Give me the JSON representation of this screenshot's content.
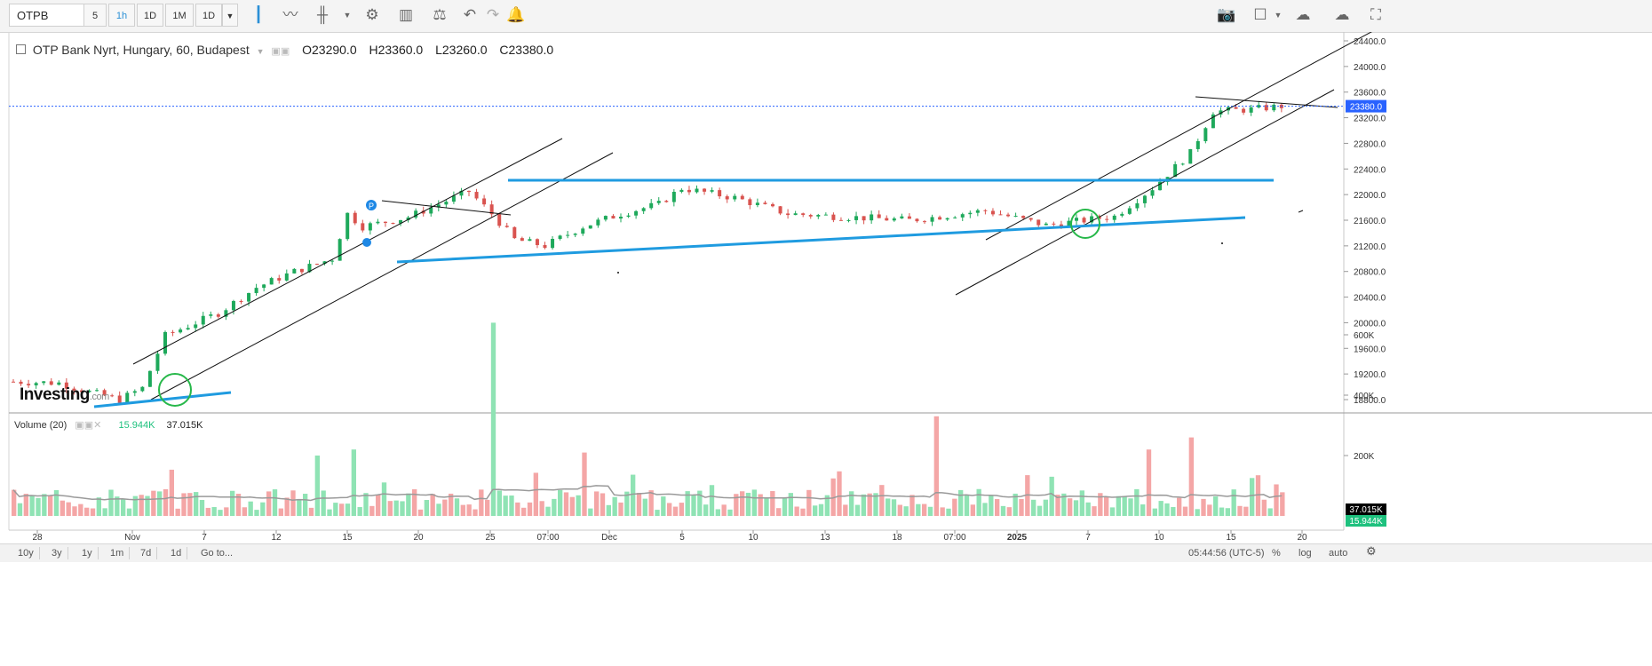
{
  "toolbar": {
    "symbol": "OTPB",
    "intervals": [
      "5",
      "1h",
      "1D",
      "1M",
      "1D"
    ],
    "active_interval": "1h"
  },
  "legend": {
    "title": "OTP Bank Nyrt, Hungary, 60, Budapest",
    "open": "O23290.0",
    "high": "H23360.0",
    "low": "L23260.0",
    "close": "C23380.0"
  },
  "volume_legend": {
    "label": "Volume (20)",
    "value1": "15.944K",
    "value2": "37.015K"
  },
  "logo": {
    "text": "Investing",
    "suffix": ".com"
  },
  "bottom_bar": {
    "ranges": [
      "10y",
      "3y",
      "1y",
      "1m",
      "7d",
      "1d",
      "Go to..."
    ],
    "clock": "05:44:56 (UTC-5)",
    "percent": "%",
    "log": "log",
    "auto": "auto"
  },
  "colors": {
    "up": "#1ea95b",
    "down": "#d9534f",
    "vol_up": "#8fe3b4",
    "vol_down": "#f4a6a6",
    "trendline_blue": "#1f9be0",
    "circle_green": "#27b84a",
    "price_marker": "#2962ff",
    "volume_ma_marker": "#000000",
    "volume_marker": "#1ec17e"
  },
  "chart_data": [
    {
      "type": "candlestick",
      "ylim": [
        18600,
        24600
      ],
      "y_ticks": [
        "24400.0",
        "24000.0",
        "23600.0",
        "23200.0",
        "22800.0",
        "22400.0",
        "22000.0",
        "21600.0",
        "21200.0",
        "20800.0",
        "20400.0",
        "20000.0",
        "19600.0",
        "19200.0",
        "18800.0"
      ],
      "x_ticks": [
        "28",
        "Nov",
        "7",
        "12",
        "15",
        "20",
        "25",
        "07:00",
        "Dec",
        "5",
        "10",
        "13",
        "18",
        "07:00",
        "2025",
        "7",
        "10",
        "15",
        "20"
      ],
      "last_price_label": "23380.0",
      "last_price": 23380,
      "close_path": [
        [
          0,
          19080
        ],
        [
          6,
          19060
        ],
        [
          10,
          18920
        ],
        [
          14,
          18800
        ],
        [
          17,
          18980
        ],
        [
          20,
          19800
        ],
        [
          27,
          20150
        ],
        [
          32,
          20550
        ],
        [
          37,
          20800
        ],
        [
          42,
          21000
        ],
        [
          44,
          21700
        ],
        [
          46,
          21500
        ],
        [
          52,
          21650
        ],
        [
          58,
          21950
        ],
        [
          60,
          22050
        ],
        [
          63,
          21700
        ],
        [
          66,
          21300
        ],
        [
          70,
          21200
        ],
        [
          75,
          21500
        ],
        [
          80,
          21700
        ],
        [
          85,
          21850
        ],
        [
          88,
          22100
        ],
        [
          95,
          21950
        ],
        [
          102,
          21700
        ],
        [
          110,
          21650
        ],
        [
          118,
          21600
        ],
        [
          128,
          21750
        ],
        [
          136,
          21520
        ],
        [
          145,
          21660
        ],
        [
          150,
          22100
        ],
        [
          155,
          22650
        ],
        [
          158,
          23300
        ],
        [
          163,
          23330
        ],
        [
          167,
          23380
        ]
      ]
    },
    {
      "type": "bar",
      "name": "Volume",
      "ylim": [
        0,
        700000
      ],
      "y_ticks": [
        "600K",
        "400K",
        "200K"
      ],
      "ma_label": "37.015K",
      "last_label": "15.944K",
      "peaks": [
        {
          "bar": 63,
          "value": 640000
        },
        {
          "bar": 122,
          "value": 330000
        },
        {
          "bar": 150,
          "value": 220000
        },
        {
          "bar": 155,
          "value": 260000
        },
        {
          "bar": 45,
          "value": 220000
        },
        {
          "bar": 75,
          "value": 210000
        },
        {
          "bar": 40,
          "value": 200000
        }
      ]
    }
  ]
}
